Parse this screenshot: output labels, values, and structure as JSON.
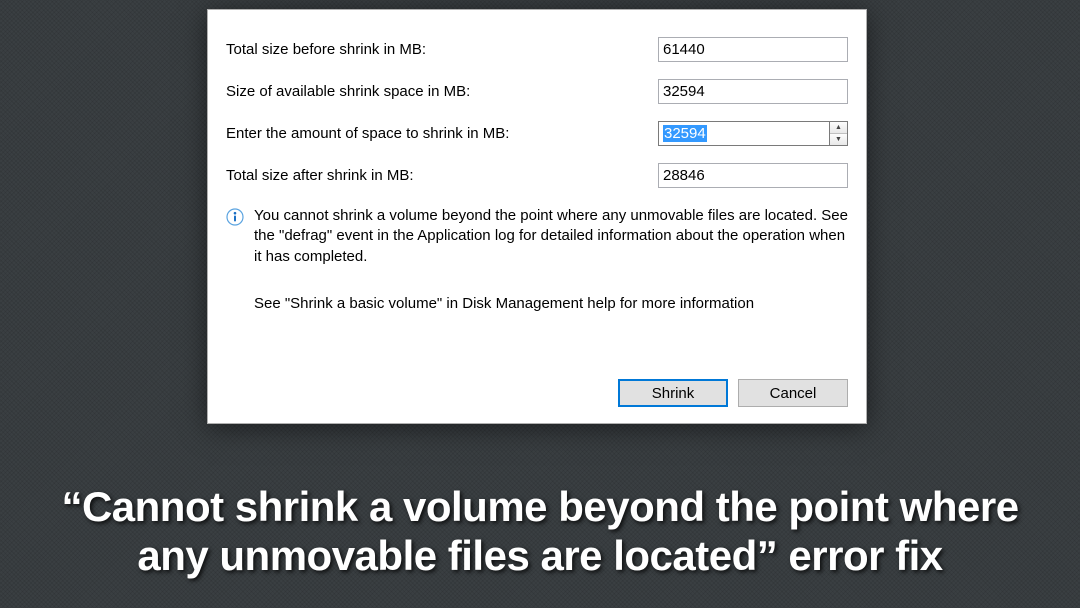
{
  "dialog": {
    "rows": {
      "totalBefore": {
        "label": "Total size before shrink in MB:",
        "value": "61440"
      },
      "available": {
        "label": "Size of available shrink space in MB:",
        "value": "32594"
      },
      "amount": {
        "label": "Enter the amount of space to shrink in MB:",
        "value": "32594"
      },
      "totalAfter": {
        "label": "Total size after shrink in MB:",
        "value": "28846"
      }
    },
    "info": "You cannot shrink a volume beyond the point where any unmovable files are located. See the \"defrag\" event in the Application log for detailed information about the operation when it has completed.",
    "infoSub": "See \"Shrink a basic volume\" in Disk Management help for more information",
    "buttons": {
      "shrink": "Shrink",
      "cancel": "Cancel"
    }
  },
  "caption": {
    "line1": "“Cannot shrink a volume beyond the point where",
    "line2": "any unmovable files are located” error fix"
  }
}
